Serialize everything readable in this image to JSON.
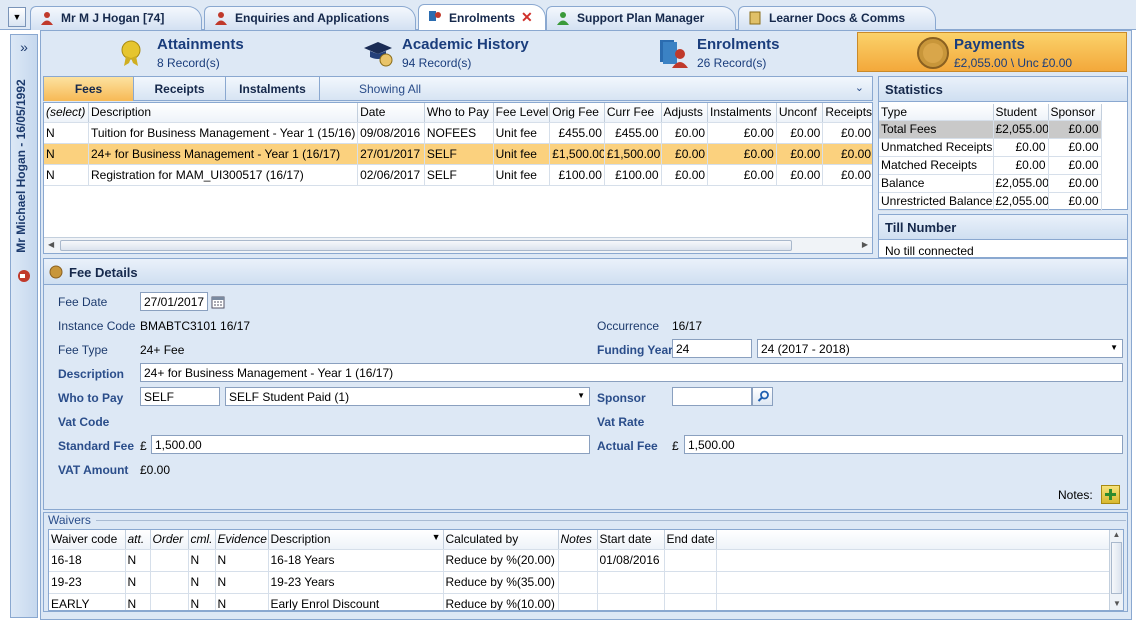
{
  "tabs": [
    {
      "label": "Mr M J Hogan [74]"
    },
    {
      "label": "Enquiries and Applications"
    },
    {
      "label": "Enrolments"
    },
    {
      "label": "Support Plan Manager"
    },
    {
      "label": "Learner Docs & Comms"
    }
  ],
  "sidebar": {
    "learner": "Mr Michael Hogan - 16/05/1992",
    "expand": "»"
  },
  "summary": {
    "attainments": {
      "title": "Attainments",
      "sub": "8 Record(s)"
    },
    "academic": {
      "title": "Academic History",
      "sub": "94 Record(s)"
    },
    "enrolments": {
      "title": "Enrolments",
      "sub": "26 Record(s)"
    },
    "payments": {
      "title": "Payments",
      "sub": "£2,055.00 \\ Unc £0.00"
    }
  },
  "subtabs": {
    "fees": "Fees",
    "receipts": "Receipts",
    "instalments": "Instalments",
    "showing": "Showing All"
  },
  "fees_table": {
    "headers": [
      "(select)",
      "Description",
      "Date",
      "Who to Pay",
      "Fee Level",
      "Orig Fee",
      "Curr Fee",
      "Adjusts",
      "Instalments",
      "Unconf",
      "Receipts"
    ],
    "rows": [
      [
        "N",
        "Tuition for Business Management - Year 1 (15/16)",
        "09/08/2016",
        "NOFEES",
        "Unit fee",
        "£455.00",
        "£455.00",
        "£0.00",
        "£0.00",
        "£0.00",
        "£0.00"
      ],
      [
        "N",
        "24+ for Business Management - Year 1 (16/17)",
        "27/01/2017",
        "SELF",
        "Unit fee",
        "£1,500.00",
        "£1,500.00",
        "£0.00",
        "£0.00",
        "£0.00",
        "£0.00"
      ],
      [
        "N",
        "Registration for MAM_UI300517 (16/17)",
        "02/06/2017",
        "SELF",
        "Unit fee",
        "£100.00",
        "£100.00",
        "£0.00",
        "£0.00",
        "£0.00",
        "£0.00"
      ]
    ]
  },
  "statistics": {
    "title": "Statistics",
    "headers": [
      "Type",
      "Student",
      "Sponsor"
    ],
    "rows": [
      [
        "Total Fees",
        "£2,055.00",
        "£0.00"
      ],
      [
        "Unmatched Receipts",
        "£0.00",
        "£0.00"
      ],
      [
        "Matched Receipts",
        "£0.00",
        "£0.00"
      ],
      [
        "Balance",
        "£2,055.00",
        "£0.00"
      ],
      [
        "Unrestricted Balance",
        "£2,055.00",
        "£0.00"
      ]
    ]
  },
  "till": {
    "title": "Till Number",
    "value": "No till connected"
  },
  "fee_details": {
    "title": "Fee Details",
    "fee_date_label": "Fee Date",
    "fee_date": "27/01/2017",
    "instance_label": "Instance Code",
    "instance": "BMABTC3101 16/17",
    "occurrence_label": "Occurrence",
    "occurrence": "16/17",
    "fee_type_label": "Fee Type",
    "fee_type": "24+ Fee",
    "funding_year_label": "Funding Year",
    "funding_year": "24",
    "funding_year_desc": "24 (2017 - 2018)",
    "description_label": "Description",
    "description": "24+ for Business Management - Year 1 (16/17)",
    "who_label": "Who to Pay",
    "who_code": "SELF",
    "who_desc": "SELF Student Paid (1)",
    "sponsor_label": "Sponsor",
    "sponsor": "",
    "vat_code_label": "Vat Code",
    "vat_rate_label": "Vat Rate",
    "standard_fee_label": "Standard Fee",
    "standard_fee": "1,500.00",
    "actual_fee_label": "Actual Fee",
    "actual_fee": "1,500.00",
    "currency": "£",
    "vat_amount_label": "VAT Amount",
    "vat_amount": "£0.00",
    "notes_label": "Notes:"
  },
  "waivers": {
    "title": "Waivers",
    "headers": [
      "Waiver code",
      "att.",
      "Order",
      "cml.",
      "Evidence",
      "Description",
      "Calculated by",
      "Notes",
      "Start date",
      "End date"
    ],
    "rows": [
      [
        "16-18",
        "N",
        "",
        "N",
        "N",
        "16-18 Years",
        "Reduce by %(20.00)",
        "",
        "01/08/2016",
        ""
      ],
      [
        "19-23",
        "N",
        "",
        "N",
        "N",
        "19-23 Years",
        "Reduce by %(35.00)",
        "",
        "",
        ""
      ],
      [
        "EARLY",
        "N",
        "",
        "N",
        "N",
        "Early Enrol Discount",
        "Reduce by %(10.00)",
        "",
        "",
        ""
      ]
    ]
  },
  "colors": {
    "accent": "#1a3d7c",
    "selected": "#fbd17e",
    "payments": "#f3a83b"
  }
}
